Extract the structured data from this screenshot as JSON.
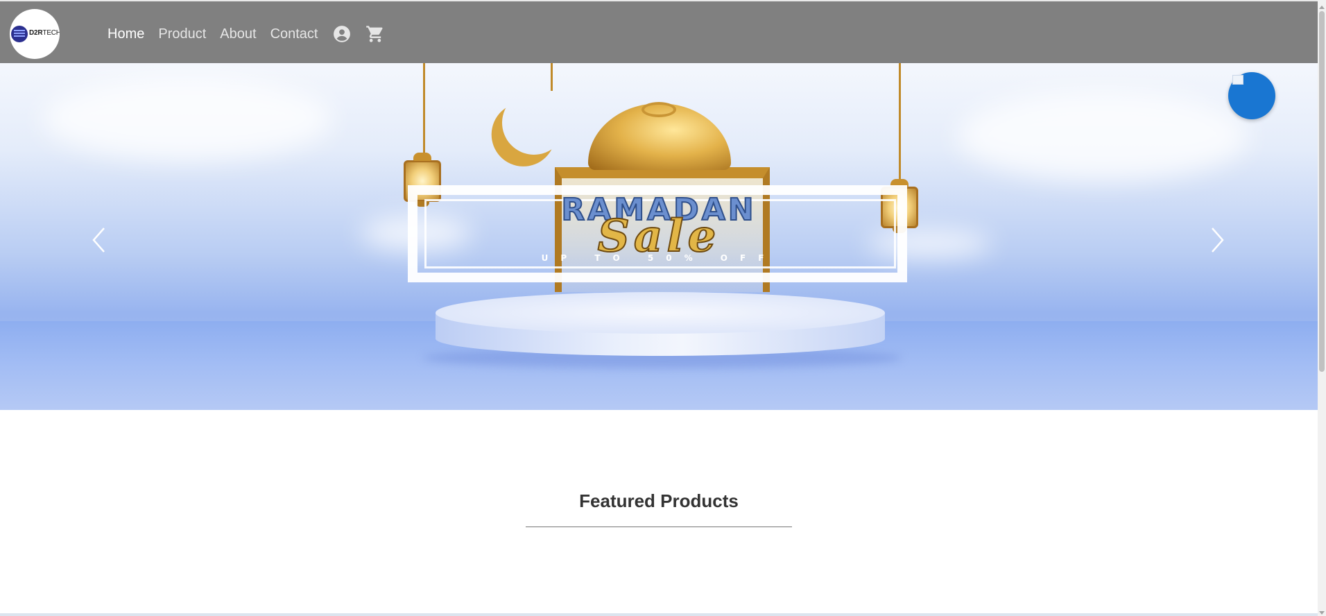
{
  "navbar": {
    "logo": {
      "text_bold": "D2R",
      "text_light": "TECH"
    },
    "links": [
      {
        "label": "Home",
        "active": true
      },
      {
        "label": "Product",
        "active": false
      },
      {
        "label": "About",
        "active": false
      },
      {
        "label": "Contact",
        "active": false
      }
    ],
    "icons": [
      "account-circle-icon",
      "shopping-cart-icon"
    ],
    "background_color": "#808080"
  },
  "hero": {
    "title": "RAMADAN",
    "script": "Sale",
    "subtitle": "UP TO 50% OFF",
    "prev_icon": "chevron-left-icon",
    "next_icon": "chevron-right-icon"
  },
  "fab": {
    "color": "#1976d2",
    "icon": "broken-image-icon"
  },
  "featured": {
    "title": "Featured Products"
  },
  "colors": {
    "accent": "#1976d2",
    "nav_bg": "#808080",
    "text": "#333333"
  }
}
